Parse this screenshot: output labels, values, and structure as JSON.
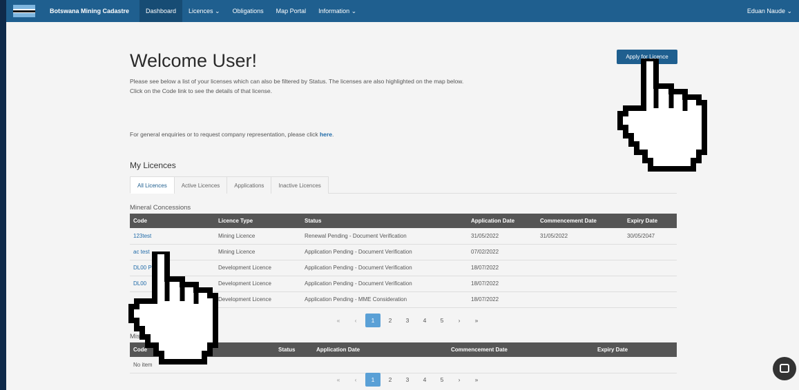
{
  "header": {
    "brand": "Botswana Mining Cadastre",
    "nav": [
      "Dashboard",
      "Licences ⌄",
      "Obligations",
      "Map Portal",
      "Information ⌄"
    ],
    "user": "Eduan Naude ⌄"
  },
  "welcome": {
    "title": "Welcome User!",
    "line1": "Please see below a list of your licenses which can also be filtered by Status. The licenses are also highlighted on the map below.",
    "line2": "Click on the Code link to see the details of that license.",
    "enquiry": "For general enquiries or to request company representation, please click ",
    "enquiry_link": "here",
    "enquiry_end": "."
  },
  "apply_button": "Apply for Licence",
  "my_licences": {
    "title": "My Licences",
    "tabs": [
      "All Licences",
      "Active Licences",
      "Applications",
      "Inactive Licences"
    ]
  },
  "mineral": {
    "title": "Mineral Concessions",
    "headers": [
      "Code",
      "Licence Type",
      "Status",
      "Application Date",
      "Commencement Date",
      "Expiry Date"
    ],
    "rows": [
      [
        "123test",
        "Mining Licence",
        "Renewal Pending - Document Verification",
        "31/05/2022",
        "31/05/2022",
        "30/05/2047"
      ],
      [
        "ac test",
        "Mining Licence",
        "Application Pending - Document Verification",
        "07/02/2022",
        "",
        ""
      ],
      [
        "DL00 P",
        "Development Licence",
        "Application Pending - Document Verification",
        "18/07/2022",
        "",
        ""
      ],
      [
        "DL00",
        "Development Licence",
        "Application Pending - Document Verification",
        "18/07/2022",
        "",
        ""
      ],
      [
        "",
        "Development Licence",
        "Application Pending - MME Consideration",
        "18/07/2022",
        "",
        ""
      ]
    ]
  },
  "misc": {
    "title": "Misc Permits",
    "headers": [
      "Code",
      "e",
      "Status",
      "Application Date",
      "Commencement Date",
      "Expiry Date"
    ],
    "empty": "No item"
  },
  "pager": {
    "first": "«",
    "prev": "‹",
    "pages": [
      "1",
      "2",
      "3",
      "4",
      "5"
    ],
    "next": "›",
    "last": "»"
  },
  "icons": {
    "chat": "chat-icon",
    "cursor": "hand-pointer-icon"
  }
}
